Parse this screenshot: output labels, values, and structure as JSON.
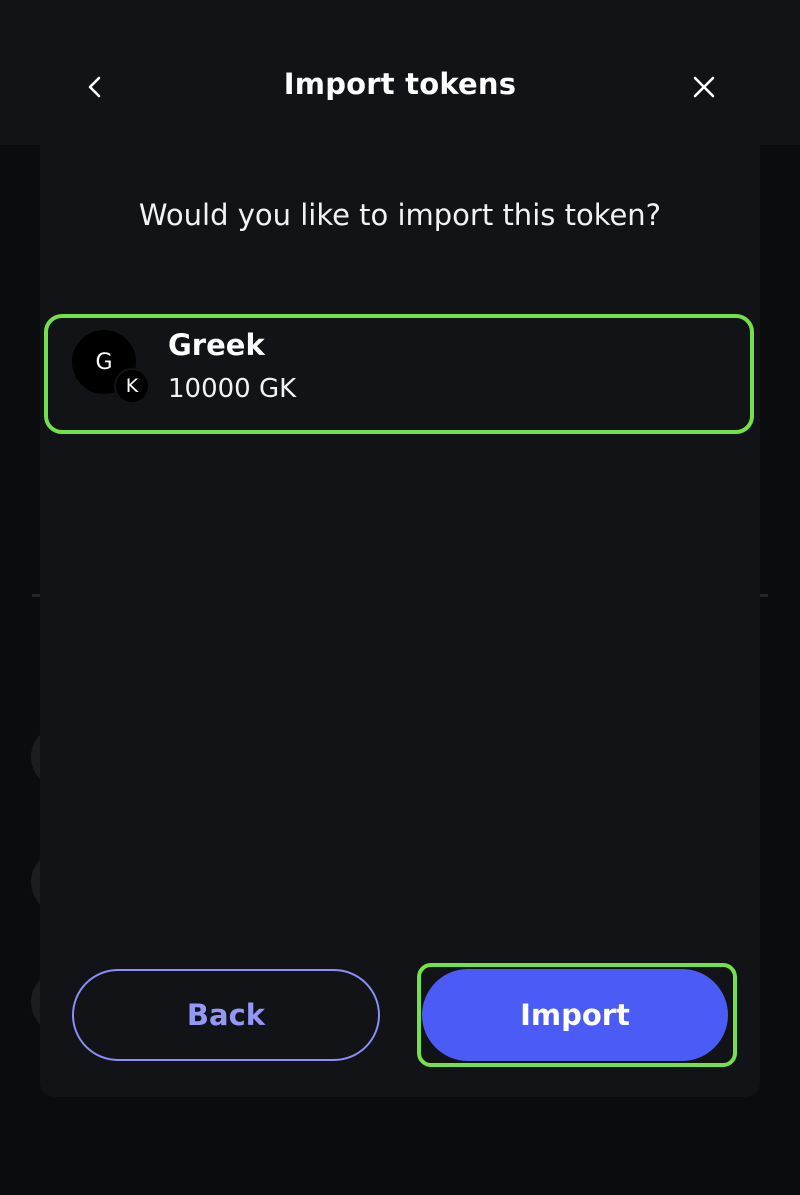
{
  "modal": {
    "title": "Import tokens",
    "question": "Would you like to import this token?"
  },
  "token": {
    "name": "Greek",
    "balance": "10000 GK",
    "avatar_letter": "G",
    "badge_letter": "K"
  },
  "buttons": {
    "back_label": "Back",
    "import_label": "Import"
  },
  "icons": {
    "back": "chevron-left-icon",
    "close": "close-icon"
  },
  "colors": {
    "modal_bg": "#121316",
    "highlight": "#73e14a",
    "primary": "#4b5cf6",
    "secondary_text": "#9597f7"
  }
}
